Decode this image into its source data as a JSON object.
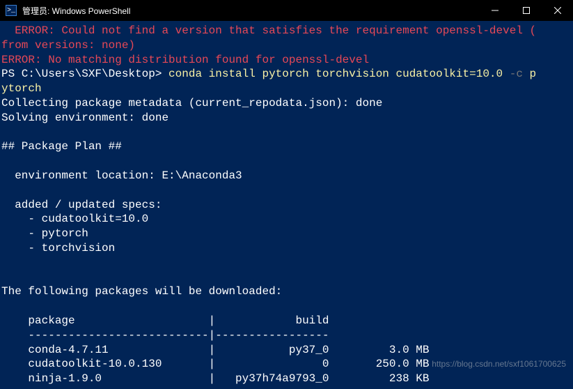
{
  "titlebar": {
    "title": "管理员: Windows PowerShell"
  },
  "terminal": {
    "error1": "  ERROR: Could not find a version that satisfies the requirement openssl-devel (",
    "error2": "from versions: none)",
    "error3": "ERROR: No matching distribution found for openssl-devel",
    "prompt": "PS C:\\Users\\SXF\\Desktop>",
    "cmd_part1": " conda install pytorch torchvision cudatoolkit=10.0 ",
    "cmd_flag": "-c",
    "cmd_part2": " p",
    "cmd_wrap": "ytorch",
    "line_collect": "Collecting package metadata (current_repodata.json): done",
    "line_solve": "Solving environment: done",
    "plan_header": "## Package Plan ##",
    "env_loc": "  environment location: E:\\Anaconda3",
    "specs_header": "  added / updated specs:",
    "spec1": "    - cudatoolkit=10.0",
    "spec2": "    - pytorch",
    "spec3": "    - torchvision",
    "download_header": "The following packages will be downloaded:",
    "table_header": "    package                    |            build",
    "table_divider": "    ---------------------------|-----------------",
    "pkg1": "    conda-4.7.11               |           py37_0         3.0 MB",
    "pkg2": "    cudatoolkit-10.0.130       |                0       250.0 MB",
    "pkg3": "    ninja-1.9.0                |   py37h74a9793_0         238 KB"
  },
  "watermark": "https://blog.csdn.net/sxf1061700625"
}
